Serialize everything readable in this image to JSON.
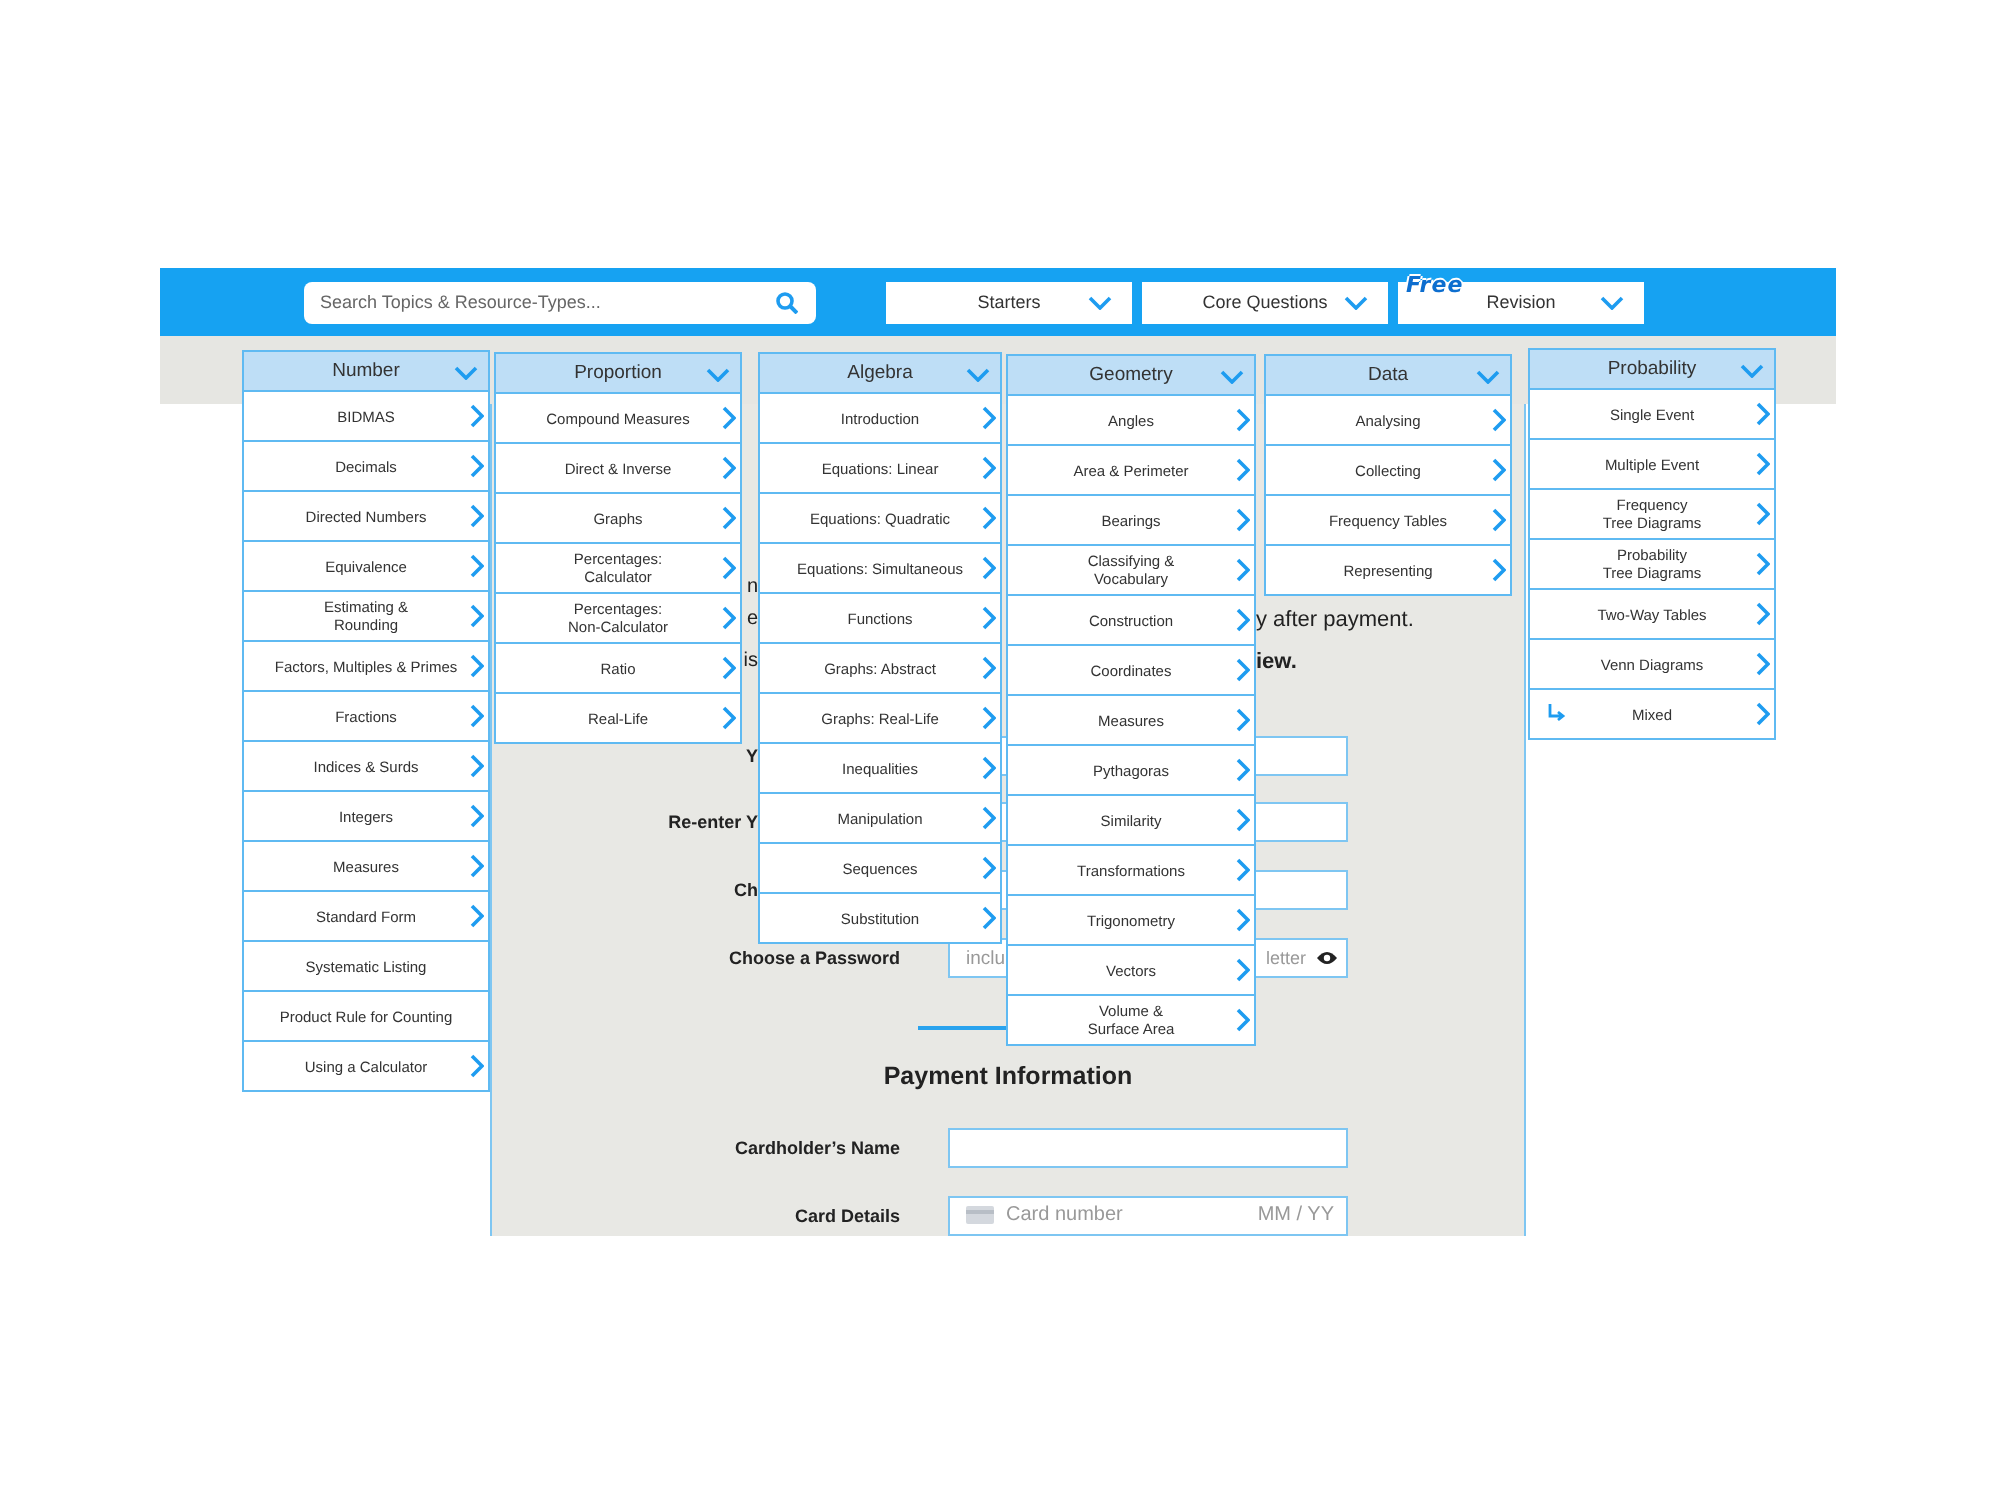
{
  "header": {
    "search": {
      "placeholder": "Search Topics & Resource-Types..."
    },
    "nav": [
      {
        "label": "Starters"
      },
      {
        "label": "Core Questions"
      },
      {
        "label": "Revision",
        "badge": "Free"
      }
    ]
  },
  "menus": [
    {
      "title": "Number",
      "items": [
        {
          "label": "BIDMAS",
          "kind": "link"
        },
        {
          "label": "Decimals",
          "kind": "link"
        },
        {
          "label": "Directed Numbers",
          "kind": "link"
        },
        {
          "label": "Equivalence",
          "kind": "link"
        },
        {
          "label": "Estimating &\nRounding",
          "kind": "link"
        },
        {
          "label": "Factors, Multiples & Primes",
          "kind": "link"
        },
        {
          "label": "Fractions",
          "kind": "link"
        },
        {
          "label": "Indices & Surds",
          "kind": "link"
        },
        {
          "label": "Integers",
          "kind": "link"
        },
        {
          "label": "Measures",
          "kind": "link"
        },
        {
          "label": "Standard Form",
          "kind": "link"
        },
        {
          "label": "Systematic Listing",
          "kind": "plain"
        },
        {
          "label": "Product Rule for Counting",
          "kind": "plain"
        },
        {
          "label": "Using a Calculator",
          "kind": "link"
        }
      ]
    },
    {
      "title": "Proportion",
      "items": [
        {
          "label": "Compound Measures",
          "kind": "link"
        },
        {
          "label": "Direct & Inverse",
          "kind": "link"
        },
        {
          "label": "Graphs",
          "kind": "link"
        },
        {
          "label": "Percentages:\nCalculator",
          "kind": "link"
        },
        {
          "label": "Percentages:\nNon-Calculator",
          "kind": "link"
        },
        {
          "label": "Ratio",
          "kind": "link"
        },
        {
          "label": "Real-Life",
          "kind": "link"
        }
      ]
    },
    {
      "title": "Algebra",
      "items": [
        {
          "label": "Introduction",
          "kind": "link"
        },
        {
          "label": "Equations: Linear",
          "kind": "link"
        },
        {
          "label": "Equations: Quadratic",
          "kind": "link"
        },
        {
          "label": "Equations: Simultaneous",
          "kind": "link"
        },
        {
          "label": "Functions",
          "kind": "link"
        },
        {
          "label": "Graphs: Abstract",
          "kind": "link"
        },
        {
          "label": "Graphs: Real-Life",
          "kind": "link"
        },
        {
          "label": "Inequalities",
          "kind": "link"
        },
        {
          "label": "Manipulation",
          "kind": "link"
        },
        {
          "label": "Sequences",
          "kind": "link"
        },
        {
          "label": "Substitution",
          "kind": "link"
        }
      ]
    },
    {
      "title": "Geometry",
      "items": [
        {
          "label": "Angles",
          "kind": "link"
        },
        {
          "label": "Area & Perimeter",
          "kind": "link"
        },
        {
          "label": "Bearings",
          "kind": "link"
        },
        {
          "label": "Classifying &\nVocabulary",
          "kind": "link"
        },
        {
          "label": "Construction",
          "kind": "link"
        },
        {
          "label": "Coordinates",
          "kind": "link"
        },
        {
          "label": "Measures",
          "kind": "link"
        },
        {
          "label": "Pythagoras",
          "kind": "link"
        },
        {
          "label": "Similarity",
          "kind": "link"
        },
        {
          "label": "Transformations",
          "kind": "link"
        },
        {
          "label": "Trigonometry",
          "kind": "link"
        },
        {
          "label": "Vectors",
          "kind": "link"
        },
        {
          "label": "Volume &\nSurface Area",
          "kind": "link"
        }
      ]
    },
    {
      "title": "Data",
      "items": [
        {
          "label": "Analysing",
          "kind": "link"
        },
        {
          "label": "Collecting",
          "kind": "link"
        },
        {
          "label": "Frequency Tables",
          "kind": "link"
        },
        {
          "label": "Representing",
          "kind": "link"
        }
      ]
    },
    {
      "title": "Probability",
      "items": [
        {
          "label": "Single Event",
          "kind": "link"
        },
        {
          "label": "Multiple Event",
          "kind": "link"
        },
        {
          "label": "Frequency\nTree Diagrams",
          "kind": "link"
        },
        {
          "label": "Probability\nTree Diagrams",
          "kind": "link"
        },
        {
          "label": "Two-Way Tables",
          "kind": "link"
        },
        {
          "label": "Venn Diagrams",
          "kind": "link"
        },
        {
          "label": "Mixed",
          "kind": "mixed"
        }
      ]
    }
  ],
  "form": {
    "notes": [
      {
        "label": "n"
      },
      {
        "label": "e",
        "text": "y after payment.",
        "bold": false
      },
      {
        "label": "is",
        "text": "iew.",
        "bold": true
      }
    ],
    "account_fields": [
      {
        "label": "Y"
      },
      {
        "label": "Re-enter Y"
      },
      {
        "label": "Ch"
      }
    ],
    "password": {
      "label": "Choose a Password",
      "hint_start": "inclu",
      "hint_end": "letter"
    },
    "payment": {
      "title": "Payment Information",
      "cardholder_label": "Cardholder’s Name",
      "card_label": "Card Details",
      "card_number_placeholder": "Card number",
      "expiry_placeholder": "MM / YY"
    }
  }
}
